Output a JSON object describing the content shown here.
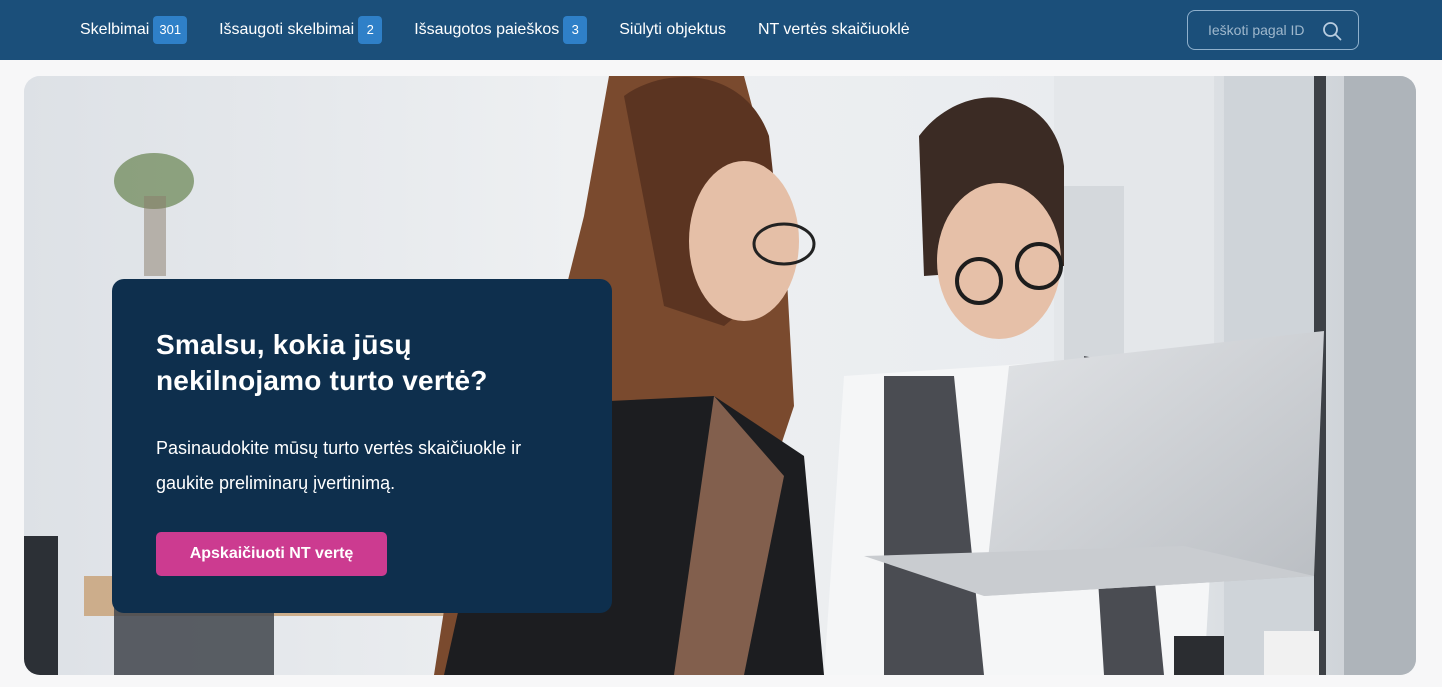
{
  "nav": {
    "items": [
      {
        "label": "Skelbimai",
        "badge": "301"
      },
      {
        "label": "Išsaugoti skelbimai",
        "badge": "2"
      },
      {
        "label": "Išsaugotos paieškos",
        "badge": "3"
      },
      {
        "label": "Siūlyti objektus",
        "badge": null
      },
      {
        "label": "NT vertės skaičiuoklė",
        "badge": null
      }
    ]
  },
  "search": {
    "placeholder": "Ieškoti pagal ID",
    "value": "",
    "icon": "search-icon"
  },
  "colors": {
    "topbar": "#1b4f7a",
    "badge": "#2f80c8",
    "card": "#0e2f4d",
    "cta": "#cc3b90"
  },
  "hero": {
    "title": "Smalsu, kokia jūsų nekilnojamo turto vertė?",
    "text": "Pasinaudokite mūsų turto vertės skaičiuokle ir gaukite preliminarų įvertinimą.",
    "cta_label": "Apskaičiuoti NT vertę"
  }
}
